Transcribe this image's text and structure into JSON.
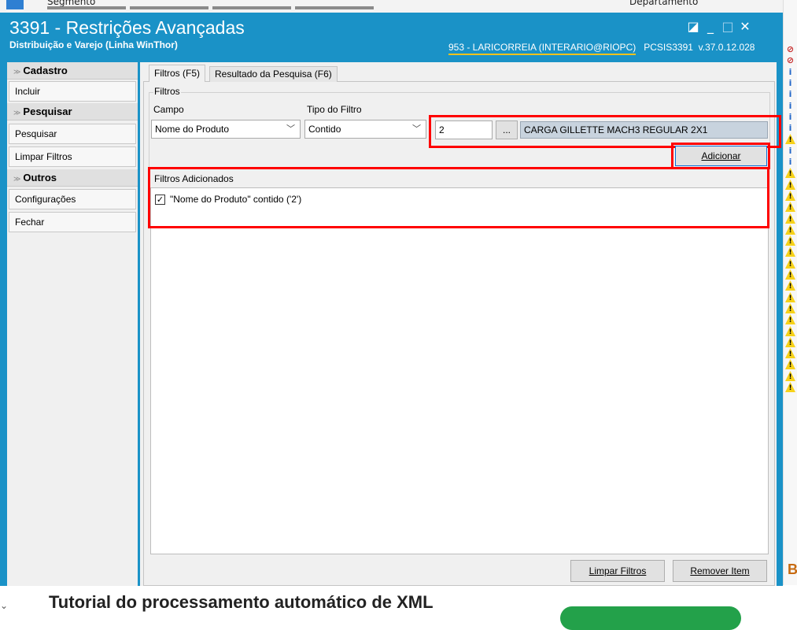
{
  "background": {
    "top_label_left": "Segmento",
    "top_label_right": "Departamento",
    "tutorial_heading": "Tutorial do processamento automático de XML",
    "right_letter": "B",
    "side_icons": [
      "no-icon",
      "no-icon",
      "info-icon",
      "info-icon",
      "info-icon",
      "info-icon",
      "info-icon",
      "info-icon",
      "warning-icon",
      "info-icon",
      "info-icon",
      "warning-icon",
      "warning-icon",
      "warning-icon",
      "warning-icon",
      "warning-icon",
      "warning-icon",
      "warning-icon",
      "warning-icon",
      "warning-icon",
      "warning-icon",
      "warning-icon",
      "warning-icon",
      "warning-icon",
      "warning-icon",
      "warning-icon",
      "warning-icon",
      "warning-icon",
      "warning-icon",
      "warning-icon",
      "warning-icon"
    ]
  },
  "window": {
    "title": "3391 - Restrições Avançadas",
    "subtitle": "Distribuição e Varejo (Linha WinThor)",
    "user": "953 - LARICORREIA (INTERARIO@RIOPC)",
    "program": "PCSIS3391",
    "version": "v.37.0.12.028",
    "controls": {
      "restore": "◪",
      "minimize": "_",
      "maximize": "□",
      "close": "✕"
    },
    "accent_color": "#1a92c7"
  },
  "sidebar": {
    "groups": [
      {
        "label": "Cadastro",
        "items": [
          "Incluir"
        ]
      },
      {
        "label": "Pesquisar",
        "items": [
          "Pesquisar",
          "Limpar Filtros"
        ]
      },
      {
        "label": "Outros",
        "items": [
          "Configurações",
          "Fechar"
        ]
      }
    ]
  },
  "tabs": [
    {
      "label": "Filtros (F5)",
      "active": true
    },
    {
      "label": "Resultado da Pesquisa (F6)",
      "active": false
    }
  ],
  "filtros": {
    "section_label": "Filtros",
    "campo_label": "Campo",
    "campo_value": "Nome do Produto",
    "tipo_label": "Tipo do Filtro",
    "tipo_value": "Contido",
    "value_input": "2",
    "lookup_button": "...",
    "lookup_result": "CARGA GILLETTE MACH3 REGULAR 2X1",
    "add_button": "Adicionar"
  },
  "filtros_adicionados": {
    "section_label": "Filtros Adicionados",
    "items": [
      {
        "text": "\"Nome do Produto\" contido ('2')",
        "checked": true
      }
    ]
  },
  "bottom_buttons": {
    "limpar": "Limpar Filtros",
    "remover": "Remover Item"
  },
  "highlight_color": "#ff0000"
}
